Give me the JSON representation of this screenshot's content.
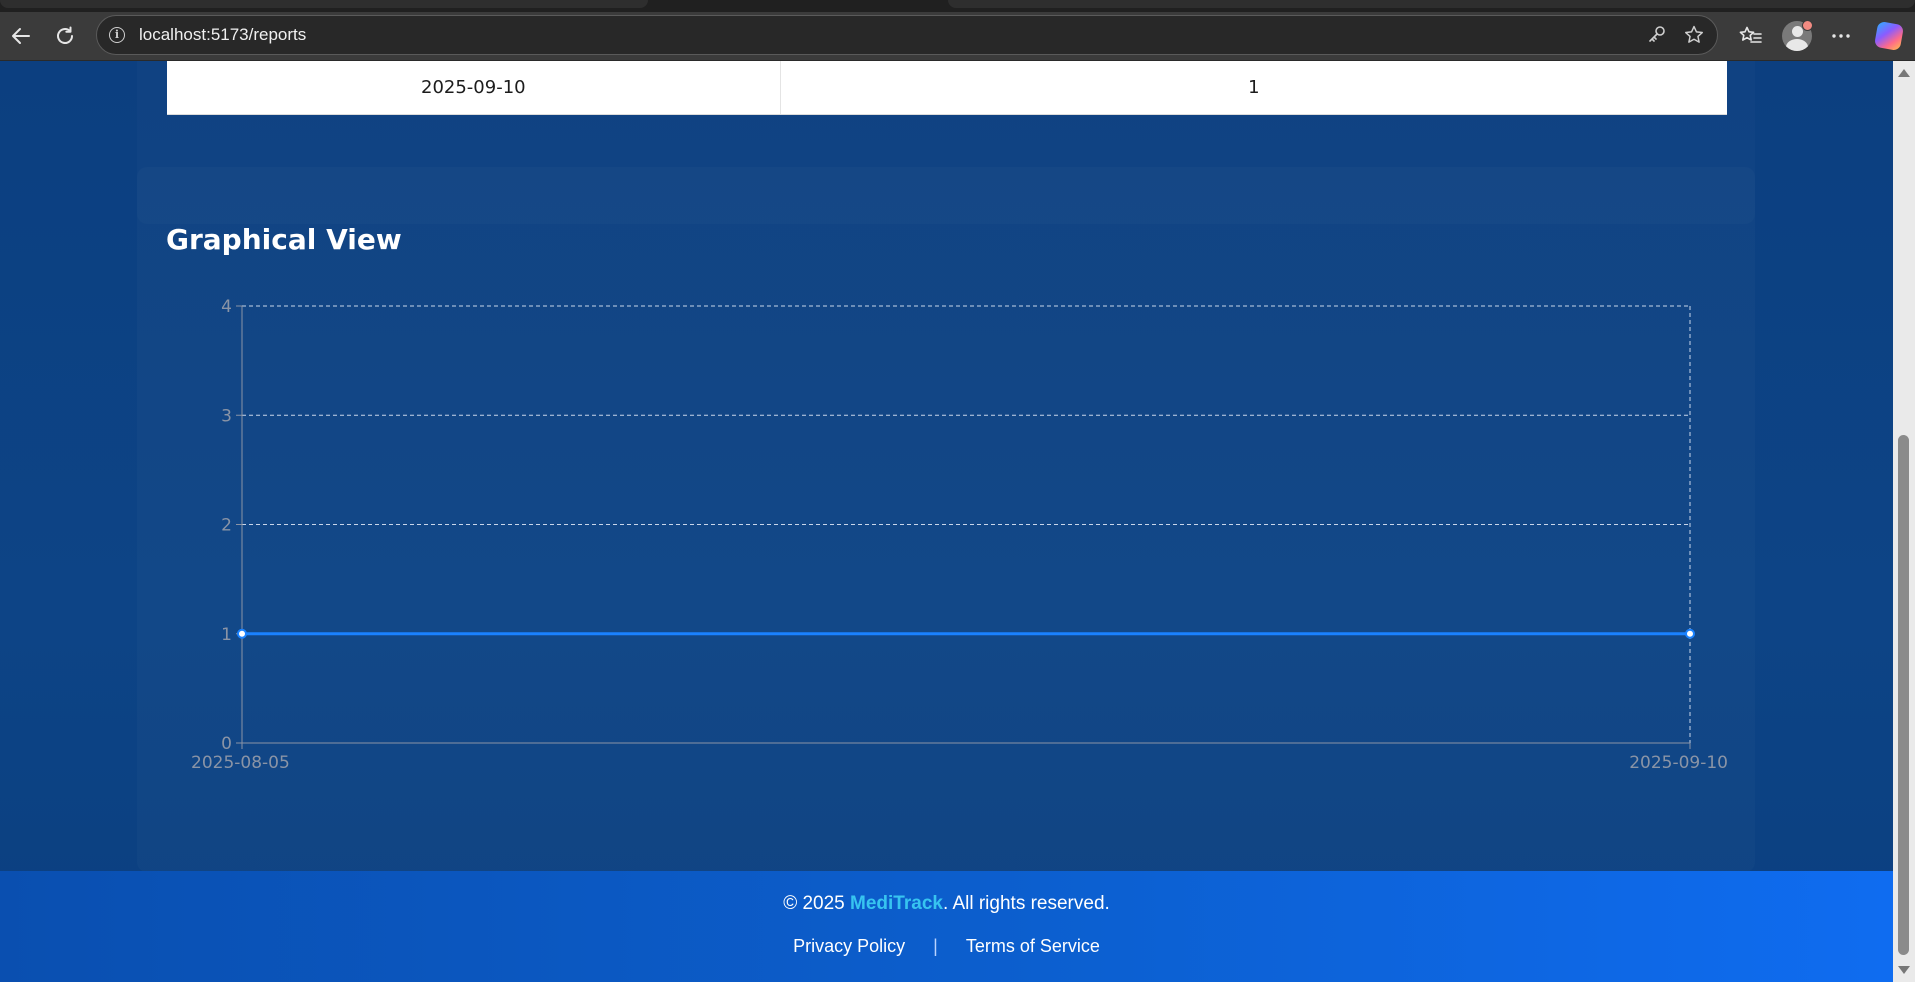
{
  "browser": {
    "url": "localhost:5173/reports"
  },
  "table": {
    "rows": [
      {
        "date": "2025-09-10",
        "count": "1"
      }
    ]
  },
  "section": {
    "title": "Graphical View"
  },
  "chart_data": {
    "type": "line",
    "x": [
      "2025-08-05",
      "2025-09-10"
    ],
    "series": [
      {
        "values": [
          1,
          1
        ],
        "color": "#1a82ff"
      }
    ],
    "ylim": [
      0,
      4
    ],
    "yticks": [
      "0",
      "1",
      "2",
      "3",
      "4"
    ],
    "xticks": [
      "2025-08-05",
      "2025-09-10"
    ],
    "grid": true,
    "title": "",
    "xlabel": "",
    "ylabel": ""
  },
  "footer": {
    "copyright_prefix": "© 2025 ",
    "brand": "MediTrack",
    "copyright_suffix": ". All rights reserved.",
    "privacy_label": "Privacy Policy",
    "separator": "|",
    "terms_label": "Terms of Service"
  },
  "colors": {
    "page_bg": "#0c3f80",
    "footer_accent": "#0f6cf0",
    "brand": "#37c4f0",
    "line": "#1a82ff"
  },
  "icons": [
    "back-icon",
    "reload-icon",
    "info-icon",
    "key-icon",
    "star-icon",
    "favorites-icon",
    "profile-icon",
    "more-icon",
    "copilot-icon"
  ]
}
